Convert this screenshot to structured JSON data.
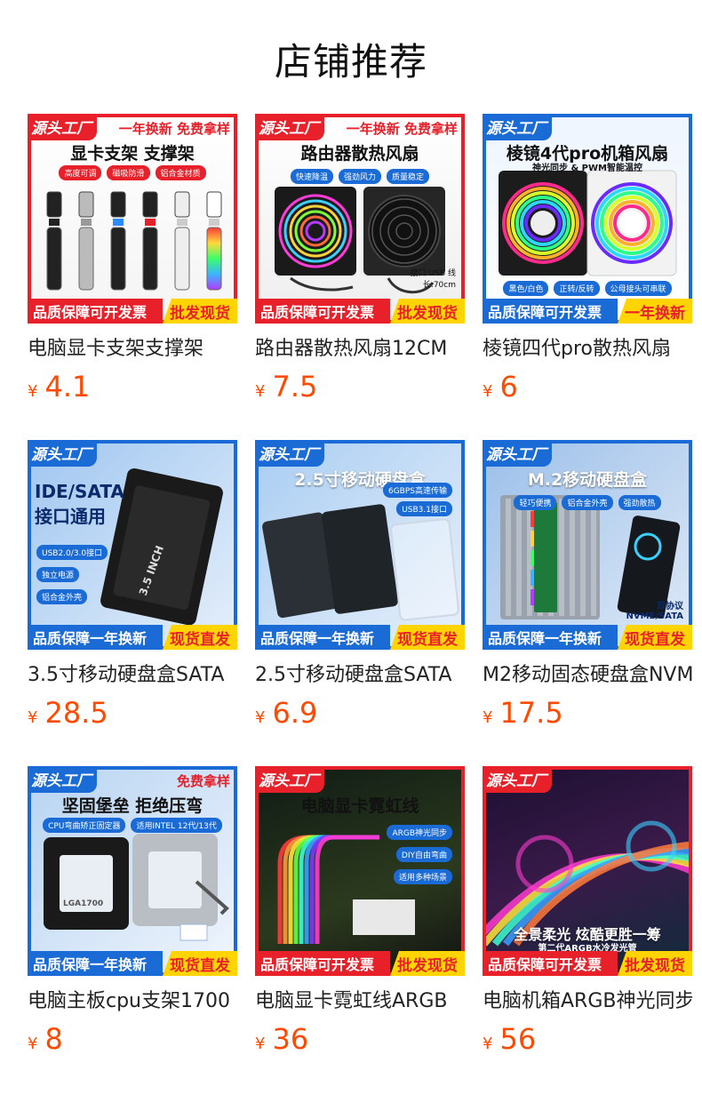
{
  "page": {
    "title": "店铺推荐"
  },
  "currency": "¥",
  "products": [
    {
      "name": "电脑显卡支架支撑架",
      "price": "4.1",
      "thumb": {
        "tag": "源头工厂",
        "promo": "一年换新  免费拿样",
        "headline": "显卡支架  支撑架",
        "chips": [
          "高度可调",
          "磁吸防滑",
          "铝合金材质"
        ],
        "bar_left": "品质保障可开发票",
        "bar_right": "批发现货"
      }
    },
    {
      "name": "路由器散热风扇12CM",
      "price": "7.5",
      "thumb": {
        "tag": "源头工厂",
        "promo": "一年换新  免费拿样",
        "headline": "路由器散热风扇",
        "chips": [
          "快速降温",
          "强劲风力",
          "质量稳定"
        ],
        "note": "接口:USB 线长:70cm",
        "bar_left": "品质保障可开发票",
        "bar_right": "批发现货"
      }
    },
    {
      "name": "棱镜四代pro散热风扇",
      "price": "6",
      "thumb": {
        "tag": "源头工厂",
        "headline": "棱镜4代pro机箱风扇",
        "sub": "神光同步 & PWM智能温控",
        "chips": [
          "黑色/白色",
          "正转/反转",
          "公母接头可串联"
        ],
        "bar_left": "品质保障可开发票",
        "bar_right": "一年换新"
      }
    },
    {
      "name": "3.5寸移动硬盘盒SATA",
      "price": "28.5",
      "thumb": {
        "tag": "源头工厂",
        "headline": "IDE/SATA 接口通用",
        "chips": [
          "USB2.0/3.0接口",
          "独立电源",
          "铝合金外壳"
        ],
        "device_label": "3.5 INCH",
        "bar_left": "品质保障一年换新",
        "bar_right": "现货直发"
      }
    },
    {
      "name": "2.5寸移动硬盘盒SATA",
      "price": "6.9",
      "thumb": {
        "tag": "源头工厂",
        "headline": "2.5寸移动硬盘盒",
        "chips": [
          "6GBPS高速传输",
          "USB3.1接口"
        ],
        "bar_left": "品质保障一年换新",
        "bar_right": "现货直发"
      }
    },
    {
      "name": "M2移动固态硬盘盒NVME",
      "price": "17.5",
      "thumb": {
        "tag": "源头工厂",
        "headline": "M.2移动硬盘盒",
        "chips": [
          "轻巧便携",
          "铝合金外壳",
          "强劲散热"
        ],
        "note": "双协议 NVME/SATA",
        "bar_left": "品质保障一年换新",
        "bar_right": "现货直发"
      }
    },
    {
      "name": "电脑主板cpu支架1700",
      "price": "8",
      "thumb": {
        "tag": "源头工厂",
        "promo": "免费拿样",
        "headline": "坚固堡垒 拒绝压弯",
        "chips": [
          "CPU弯曲矫正固定器",
          "适用INTEL 12代/13代"
        ],
        "device_label": "LGA1700",
        "bar_left": "品质保障一年换新",
        "bar_right": "现货直发"
      }
    },
    {
      "name": "电脑显卡霓虹线ARGB",
      "price": "36",
      "thumb": {
        "tag": "源头工厂",
        "headline": "电脑显卡霓虹线",
        "chips": [
          "ARGB神光同步",
          "DIY自由弯曲",
          "适用多种场景"
        ],
        "bar_left": "品质保障可开发票",
        "bar_right": "批发现货"
      }
    },
    {
      "name": "电脑机箱ARGB神光同步",
      "price": "56",
      "thumb": {
        "tag": "源头工厂",
        "headline": "全景柔光  炫酷更胜一筹",
        "sub": "第二代ARGB水冷发光管",
        "bar_left": "品质保障可开发票",
        "bar_right": "批发现货"
      }
    }
  ]
}
